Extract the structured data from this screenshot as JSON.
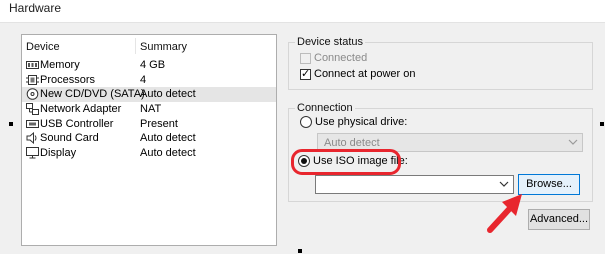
{
  "window": {
    "title": "Hardware"
  },
  "device_list": {
    "headers": {
      "device": "Device",
      "summary": "Summary"
    },
    "rows": [
      {
        "icon": "memory-icon",
        "device": "Memory",
        "summary": "4 GB",
        "selected": false
      },
      {
        "icon": "processor-icon",
        "device": "Processors",
        "summary": "4",
        "selected": false
      },
      {
        "icon": "cd-dvd-icon",
        "device": "New CD/DVD (SATA)",
        "summary": "Auto detect",
        "selected": true
      },
      {
        "icon": "network-adapter-icon",
        "device": "Network Adapter",
        "summary": "NAT",
        "selected": false
      },
      {
        "icon": "usb-controller-icon",
        "device": "USB Controller",
        "summary": "Present",
        "selected": false
      },
      {
        "icon": "sound-card-icon",
        "device": "Sound Card",
        "summary": "Auto detect",
        "selected": false
      },
      {
        "icon": "display-icon",
        "device": "Display",
        "summary": "Auto detect",
        "selected": false
      }
    ]
  },
  "device_status": {
    "legend": "Device status",
    "connected": {
      "label": "Connected",
      "checked": false,
      "enabled": false
    },
    "connect_at_power_on": {
      "label": "Connect at power on",
      "checked": true,
      "enabled": true
    }
  },
  "connection": {
    "legend": "Connection",
    "use_physical_drive": {
      "label": "Use physical drive:",
      "selected": false
    },
    "physical_drive_value": "Auto detect",
    "use_iso_image": {
      "label": "Use ISO image file:",
      "selected": true
    },
    "iso_path_value": "",
    "browse_label": "Browse..."
  },
  "advanced_label": "Advanced...",
  "colors": {
    "highlight": "#e8262e",
    "focus_border": "#0078d7",
    "selection": "#e5e5e5"
  }
}
